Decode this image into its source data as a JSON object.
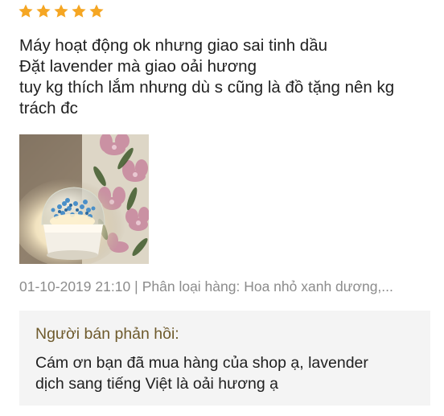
{
  "review": {
    "rating": 5,
    "star_color": "#f5a623",
    "text_lines": [
      "Máy hoạt động ok nhưng giao sai tinh dầu",
      "Đặt lavender mà giao oải hương",
      "tuy kg thích lắm nhưng dù s cũng là đồ tặng nên kg",
      "trách đc"
    ],
    "timestamp": "01-10-2019 21:10",
    "separator": "|",
    "variation": "Phân loại hàng: Hoa nhỏ xanh dương,..."
  },
  "seller": {
    "title": "Người bán phản hồi:",
    "reply_lines": [
      "Cám ơn bạn đã mua hàng của shop ạ, lavender",
      "dịch sang tiếng Việt là oải hương ạ"
    ]
  }
}
